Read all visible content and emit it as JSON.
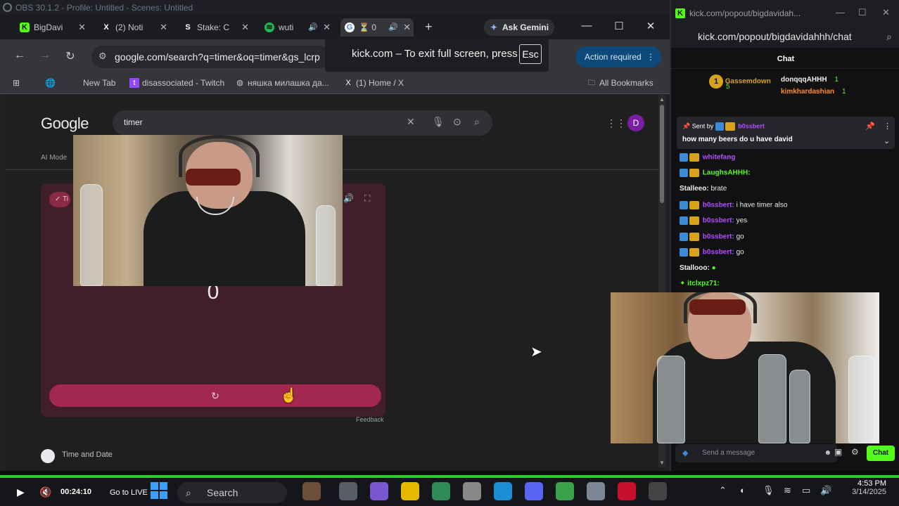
{
  "obs": {
    "title": "OBS 30.1.2 - Profile: Untitled - Scenes: Untitled"
  },
  "browser": {
    "tabs": [
      {
        "label": "BigDavi",
        "icon": "kick-icon",
        "color": "#53fc18"
      },
      {
        "label": "(2) Noti",
        "icon": "x-icon",
        "color": "#ffffff"
      },
      {
        "label": "Stake: C",
        "icon": "stake-icon",
        "color": "#ffffff"
      },
      {
        "label": "wuti",
        "icon": "spotify-icon",
        "color": "#1db954"
      },
      {
        "label": "⏳ 0",
        "icon": "google-icon",
        "color": "#4285f4"
      }
    ],
    "ask_gemini": "Ask Gemini",
    "url": "google.com/search?q=timer&oq=timer&gs_lcrp",
    "action_required": "Action required",
    "fullscreen_notice": "kick.com – To exit full screen, press",
    "fullscreen_key": "Esc",
    "bookmarks": [
      {
        "label": "New Tab"
      },
      {
        "label": "disassociated - Twitch"
      },
      {
        "label": "няшка милашка да..."
      },
      {
        "label": "(1) Home / X"
      }
    ],
    "all_bookmarks": "All Bookmarks"
  },
  "google": {
    "logo": "Google",
    "query": "timer",
    "avatar_letter": "D",
    "ai_mode": "AI Mode",
    "timer_value": "0",
    "timer_chip": "Ti",
    "reset_symbol": "↻",
    "feedback": "Feedback",
    "result_title": "Time and Date"
  },
  "chat": {
    "window_title": "kick.com/popout/bigdavidah...",
    "url": "kick.com/popout/bigdavidahhh/chat",
    "header": "Chat",
    "gifters": [
      {
        "name": "Gassemdown",
        "count": "5"
      },
      {
        "name": "donqqqAHHH",
        "count": "1"
      },
      {
        "name": "kimkhardashian",
        "count": "1"
      }
    ],
    "pinned_by_label": "Sent by",
    "pinned_by_user": "b0ssbert",
    "pinned_message": "how many beers do u have david",
    "messages": [
      {
        "user": "whitefang",
        "text": "",
        "user_class": "u-purple"
      },
      {
        "user": "LaughsAHHH:",
        "text": "",
        "user_class": "u-green"
      },
      {
        "user": "Stalleeo:",
        "text": "brate",
        "user_class": "u-white"
      },
      {
        "user": "b0ssbert:",
        "text": "i have timer also",
        "user_class": "u-purple"
      },
      {
        "user": "b0ssbert:",
        "text": "yes",
        "user_class": "u-purple"
      },
      {
        "user": "b0ssbert:",
        "text": "go",
        "user_class": "u-purple"
      },
      {
        "user": "b0ssbert:",
        "text": "go",
        "user_class": "u-purple"
      },
      {
        "user": "Stallooo:",
        "text": "",
        "user_class": "u-white"
      },
      {
        "user": "itclxpz71:",
        "text": "",
        "user_class": "u-green"
      }
    ],
    "input_placeholder": "Send a message",
    "send_button": "Chat"
  },
  "player": {
    "time": "00:24:10",
    "go_live": "Go to LIVE"
  },
  "taskbar": {
    "search": "Search",
    "time": "4:53 PM",
    "date": "3/14/2025"
  }
}
